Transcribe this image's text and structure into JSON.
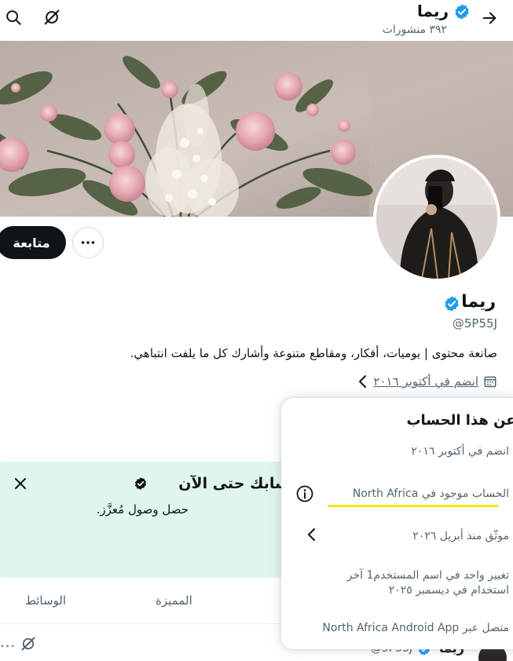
{
  "header": {
    "name": "ريما",
    "posts_count": "٣٩٢ منشورات"
  },
  "profile": {
    "name": "ريما",
    "handle": "@5P55J",
    "bio": "صانعة محتوى | يوميات، أفكار، ومقاطع متنوعة وأشارك كل ما يلفت انتباهي.",
    "joined": "انضم في أكتوبر ٢٠١٦",
    "follow_label": "متابعة"
  },
  "promo": {
    "title": "حسابك حتى الآن",
    "body": "حصل وصول مُعزَّز."
  },
  "tabs": {
    "highlights": "المميزة",
    "media": "الوسائط"
  },
  "pinned_post": {
    "author_name": "ريما",
    "handle_fragment": "@5P55J"
  },
  "about_account": {
    "title": "نبذة عن هذا الحساب",
    "joined": "انضم في أكتوبر ٢٠١٦",
    "location": "الحساب موجود في North Africa",
    "verified_since": "موثّق منذ أبريل ٢٠٢٦",
    "username_change_line1": "تغيير واحد في اسم المستخدم1 آخر",
    "username_change_line2": "استخدام في ديسمبر ٢٠٢٥",
    "connected_via": "متصل عبر North Africa Android App"
  },
  "colors": {
    "verified_blue": "#1d9bf0",
    "promo_bg": "#e1f6ea",
    "highlight_underline": "#f5e60a",
    "text_primary": "#0f1419",
    "text_secondary": "#536471"
  },
  "icons": {
    "back": "arrow-right-icon",
    "grok": "grok-icon",
    "search": "search-icon",
    "more": "more-horizontal-icon",
    "calendar": "calendar-icon",
    "info": "info-icon",
    "chevron": "chevron-left-icon",
    "close": "close-icon"
  }
}
